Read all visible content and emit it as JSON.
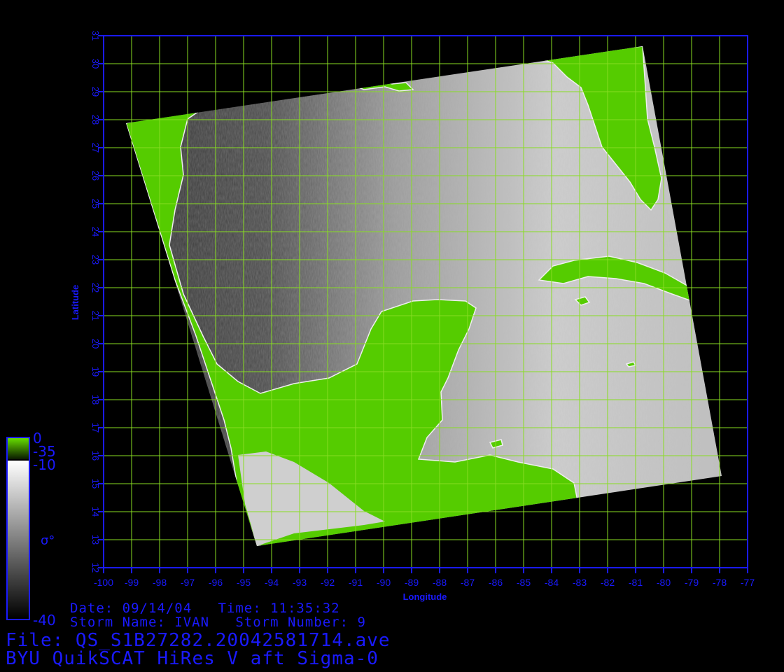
{
  "map": {
    "title": "BYU QuikSCAT HiRes V aft Sigma-0",
    "file_label": "File: QS_S1B27282.20042581714.ave",
    "date_time_label": "Date: 09/14/04   Time: 11:35:32",
    "storm_label": "Storm Name: IVAN   Storm Number: 9",
    "x_axis_label": "Longitude",
    "y_axis_label": "Latitude",
    "longitude_ticks": [
      "-100",
      "-99",
      "-98",
      "-97",
      "-96",
      "-95",
      "-94",
      "-93",
      "-92",
      "-91",
      "-90",
      "-89",
      "-88",
      "-87",
      "-86",
      "-85",
      "-84",
      "-83",
      "-82",
      "-81",
      "-80",
      "-79",
      "-78",
      "-77"
    ],
    "latitude_ticks": [
      "12",
      "13",
      "14",
      "15",
      "16",
      "17",
      "18",
      "19",
      "20",
      "21",
      "22",
      "23",
      "24",
      "25",
      "26",
      "27",
      "28",
      "29",
      "30",
      "31"
    ],
    "lon_range": [
      -100,
      -77
    ],
    "lat_range": [
      12,
      31
    ],
    "colorbar": {
      "symbol": "σ°",
      "land_top": "0",
      "land_bottom": "-35",
      "gray_top": "-10",
      "gray_bottom": "-40"
    },
    "colors": {
      "land": "#55cc00",
      "grid": "#88dd22",
      "axis": "#1a1aff",
      "background": "#000000"
    }
  }
}
